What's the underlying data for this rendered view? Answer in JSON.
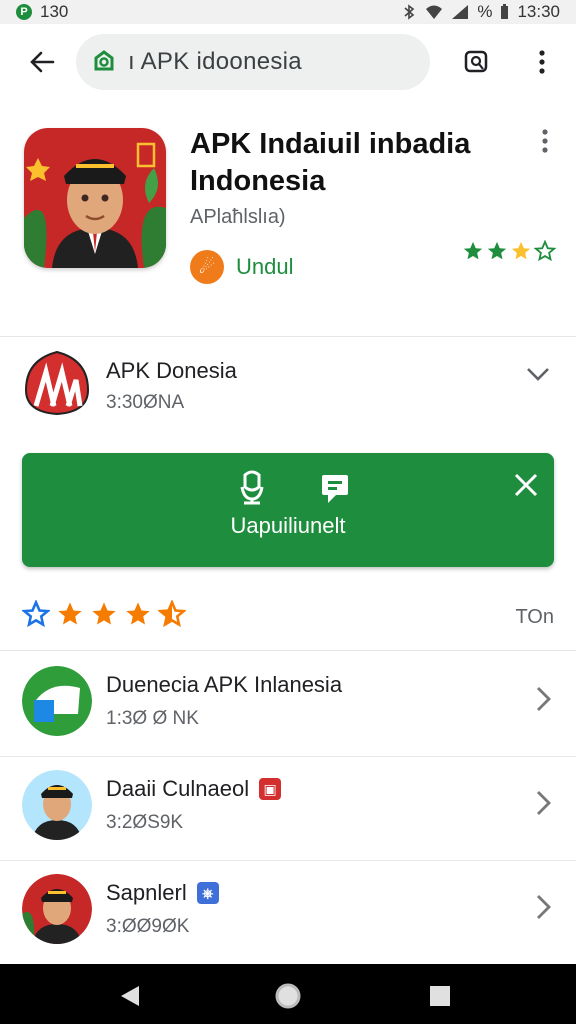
{
  "status_bar": {
    "time_left": "130",
    "time_right": "13:30"
  },
  "search": {
    "query": "ı APK idoonesia"
  },
  "hero": {
    "title": "APK Indaiuil inbadia Indonesia",
    "subtitle": "APlaħlslıa)",
    "install_label": "Undul",
    "rating_stars": 4
  },
  "primary_app": {
    "name": "APK Donesia",
    "size": "3:30ØNA"
  },
  "action_button": {
    "label": "Uapuiliunelt"
  },
  "rating_row": {
    "stars": 5,
    "trailing": "TOn"
  },
  "list": [
    {
      "title": "Duenecia APK Inlanesia",
      "size": "1:3Ø Ø NK"
    },
    {
      "title": "Daaii Culnaeol",
      "size": "3:2ØS9K"
    },
    {
      "title": "Sapnlerl",
      "size": "3:ØØ9ØK"
    }
  ],
  "colors": {
    "accent_green": "#1e8e3e",
    "orange": "#f07b1b",
    "red": "#c62828"
  }
}
